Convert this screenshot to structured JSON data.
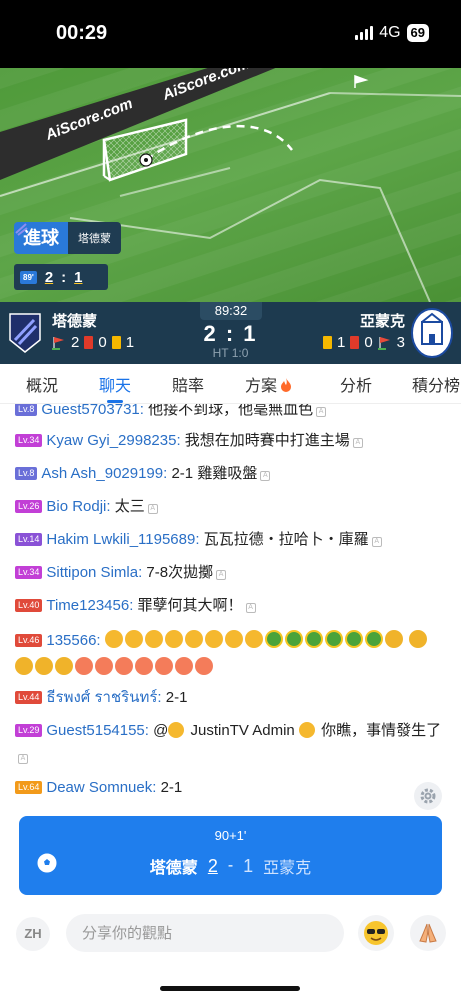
{
  "status_bar": {
    "time": "00:29",
    "network": "4G",
    "battery": "69"
  },
  "animation": {
    "ad_text_1": "AiScore.com",
    "ad_text_2": "AiScore.com",
    "event_label": "進球",
    "event_team": "塔德蒙",
    "minute": "89'",
    "home_score": "2",
    "separator": ":",
    "away_score": "1"
  },
  "scoreboard": {
    "clock": "89:32",
    "score": "2 : 1",
    "half_time": "HT 1:0",
    "home": {
      "name": "塔德蒙",
      "corners": "2",
      "red_cards": "0",
      "yellow_cards": "1"
    },
    "away": {
      "name": "亞蒙克",
      "yellow_cards": "1",
      "red_cards": "0",
      "corners": "3"
    }
  },
  "tabs": [
    {
      "label": "概況",
      "active": false
    },
    {
      "label": "聊天",
      "active": true
    },
    {
      "label": "賠率",
      "active": false
    },
    {
      "label": "方案",
      "active": false,
      "icon": "fire-icon"
    },
    {
      "label": "分析",
      "active": false
    },
    {
      "label": "積分榜",
      "active": false
    }
  ],
  "chat": [
    {
      "level": "Lv.8",
      "level_color": "#6a6fd8",
      "user": "Guest5703731:",
      "text": "他接不到球，他毫無血色"
    },
    {
      "level": "Lv.34",
      "level_color": "#c23fd6",
      "user": "Kyaw Gyi_2998235:",
      "text": "我想在加時賽中打進主場"
    },
    {
      "level": "Lv.8",
      "level_color": "#6a6fd8",
      "user": "Ash Ash_9029199:",
      "text": "2-1 雞雞吸盤"
    },
    {
      "level": "Lv.26",
      "level_color": "#c23fd6",
      "user": "Bio Rodji:",
      "text": "太三"
    },
    {
      "level": "Lv.14",
      "level_color": "#8a52d6",
      "user": "Hakim Lwkili_1195689:",
      "text": "瓦瓦拉德・拉哈卜・庫羅"
    },
    {
      "level": "Lv.34",
      "level_color": "#c23fd6",
      "user": "Sittipon Simla:",
      "text": "7-8次拋擲"
    },
    {
      "level": "Lv.40",
      "level_color": "#e04a3a",
      "user": "Time123456:",
      "text": "罪孽何其大啊！"
    },
    {
      "level": "Lv.46",
      "level_color": "#e04a3a",
      "user": "135566:",
      "text": ""
    },
    {
      "level": "Lv.44",
      "level_color": "#e04a3a",
      "user": "ธีรพงศ์ ราชรินทร์:",
      "text": "2-1"
    },
    {
      "level": "Lv.29",
      "level_color": "#c23fd6",
      "user": "Guest5154155:",
      "text_prefix": "@",
      "mention": "JustinTV Admin",
      "text": "你瞧，事情發生了"
    },
    {
      "level": "Lv.64",
      "level_color": "#f29a1a",
      "user": "Deaw Somnuek:",
      "text": "2-1"
    }
  ],
  "goal_toast": {
    "minute": "90+1'",
    "home": "塔德蒙",
    "home_score": "2",
    "dash": "-",
    "away_score": "1",
    "away": "亞蒙克"
  },
  "input_bar": {
    "lang": "ZH",
    "placeholder": "分享你的觀點"
  }
}
